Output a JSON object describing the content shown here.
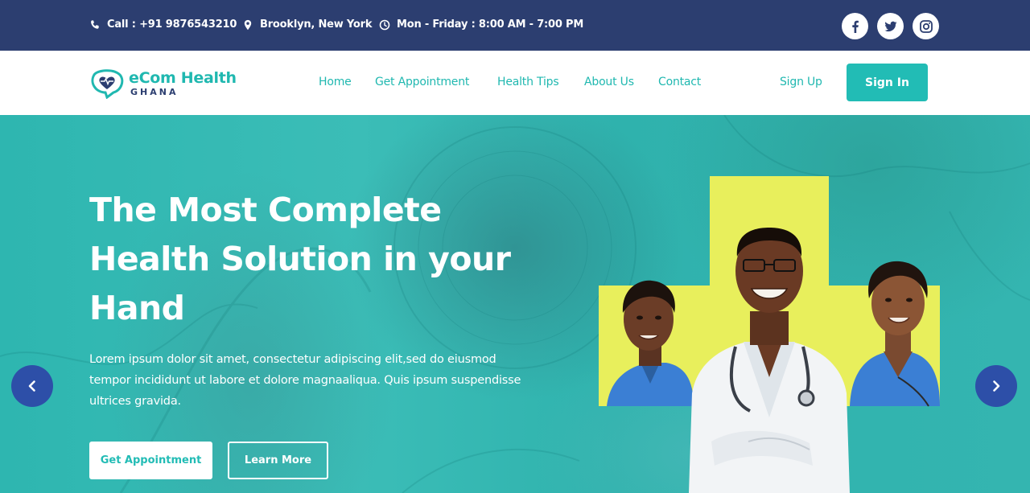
{
  "topbar": {
    "phone": "Call : +91 9876543210",
    "location": "Brooklyn, New York",
    "hours": "Mon - Friday : 8:00 AM - 7:00 PM",
    "social": [
      "facebook-icon",
      "twitter-icon",
      "instagram-icon"
    ]
  },
  "brand": {
    "name": "eCom Health",
    "sub": "GHANA"
  },
  "nav": {
    "items": [
      {
        "label": "Home"
      },
      {
        "label": "Get Appointment"
      },
      {
        "label": "Health Tips"
      },
      {
        "label": "About Us"
      },
      {
        "label": "Contact"
      }
    ],
    "signup": "Sign Up",
    "signin": "Sign In"
  },
  "hero": {
    "title": "The Most Complete Health Solution in your Hand",
    "text": "Lorem ipsum dolor sit amet, consectetur adipiscing elit,sed do eiusmod tempor incididunt ut labore et dolore magnaaliqua. Quis ipsum suspendisse ultrices gravida.",
    "primary_button": "Get Appointment",
    "secondary_button": "Learn More"
  },
  "colors": {
    "topbar": "#2c3e70",
    "accent": "#22bcb5",
    "hero": "#34b5b0",
    "cross": "#e8ef5c",
    "arrow": "#2d4fa8"
  }
}
